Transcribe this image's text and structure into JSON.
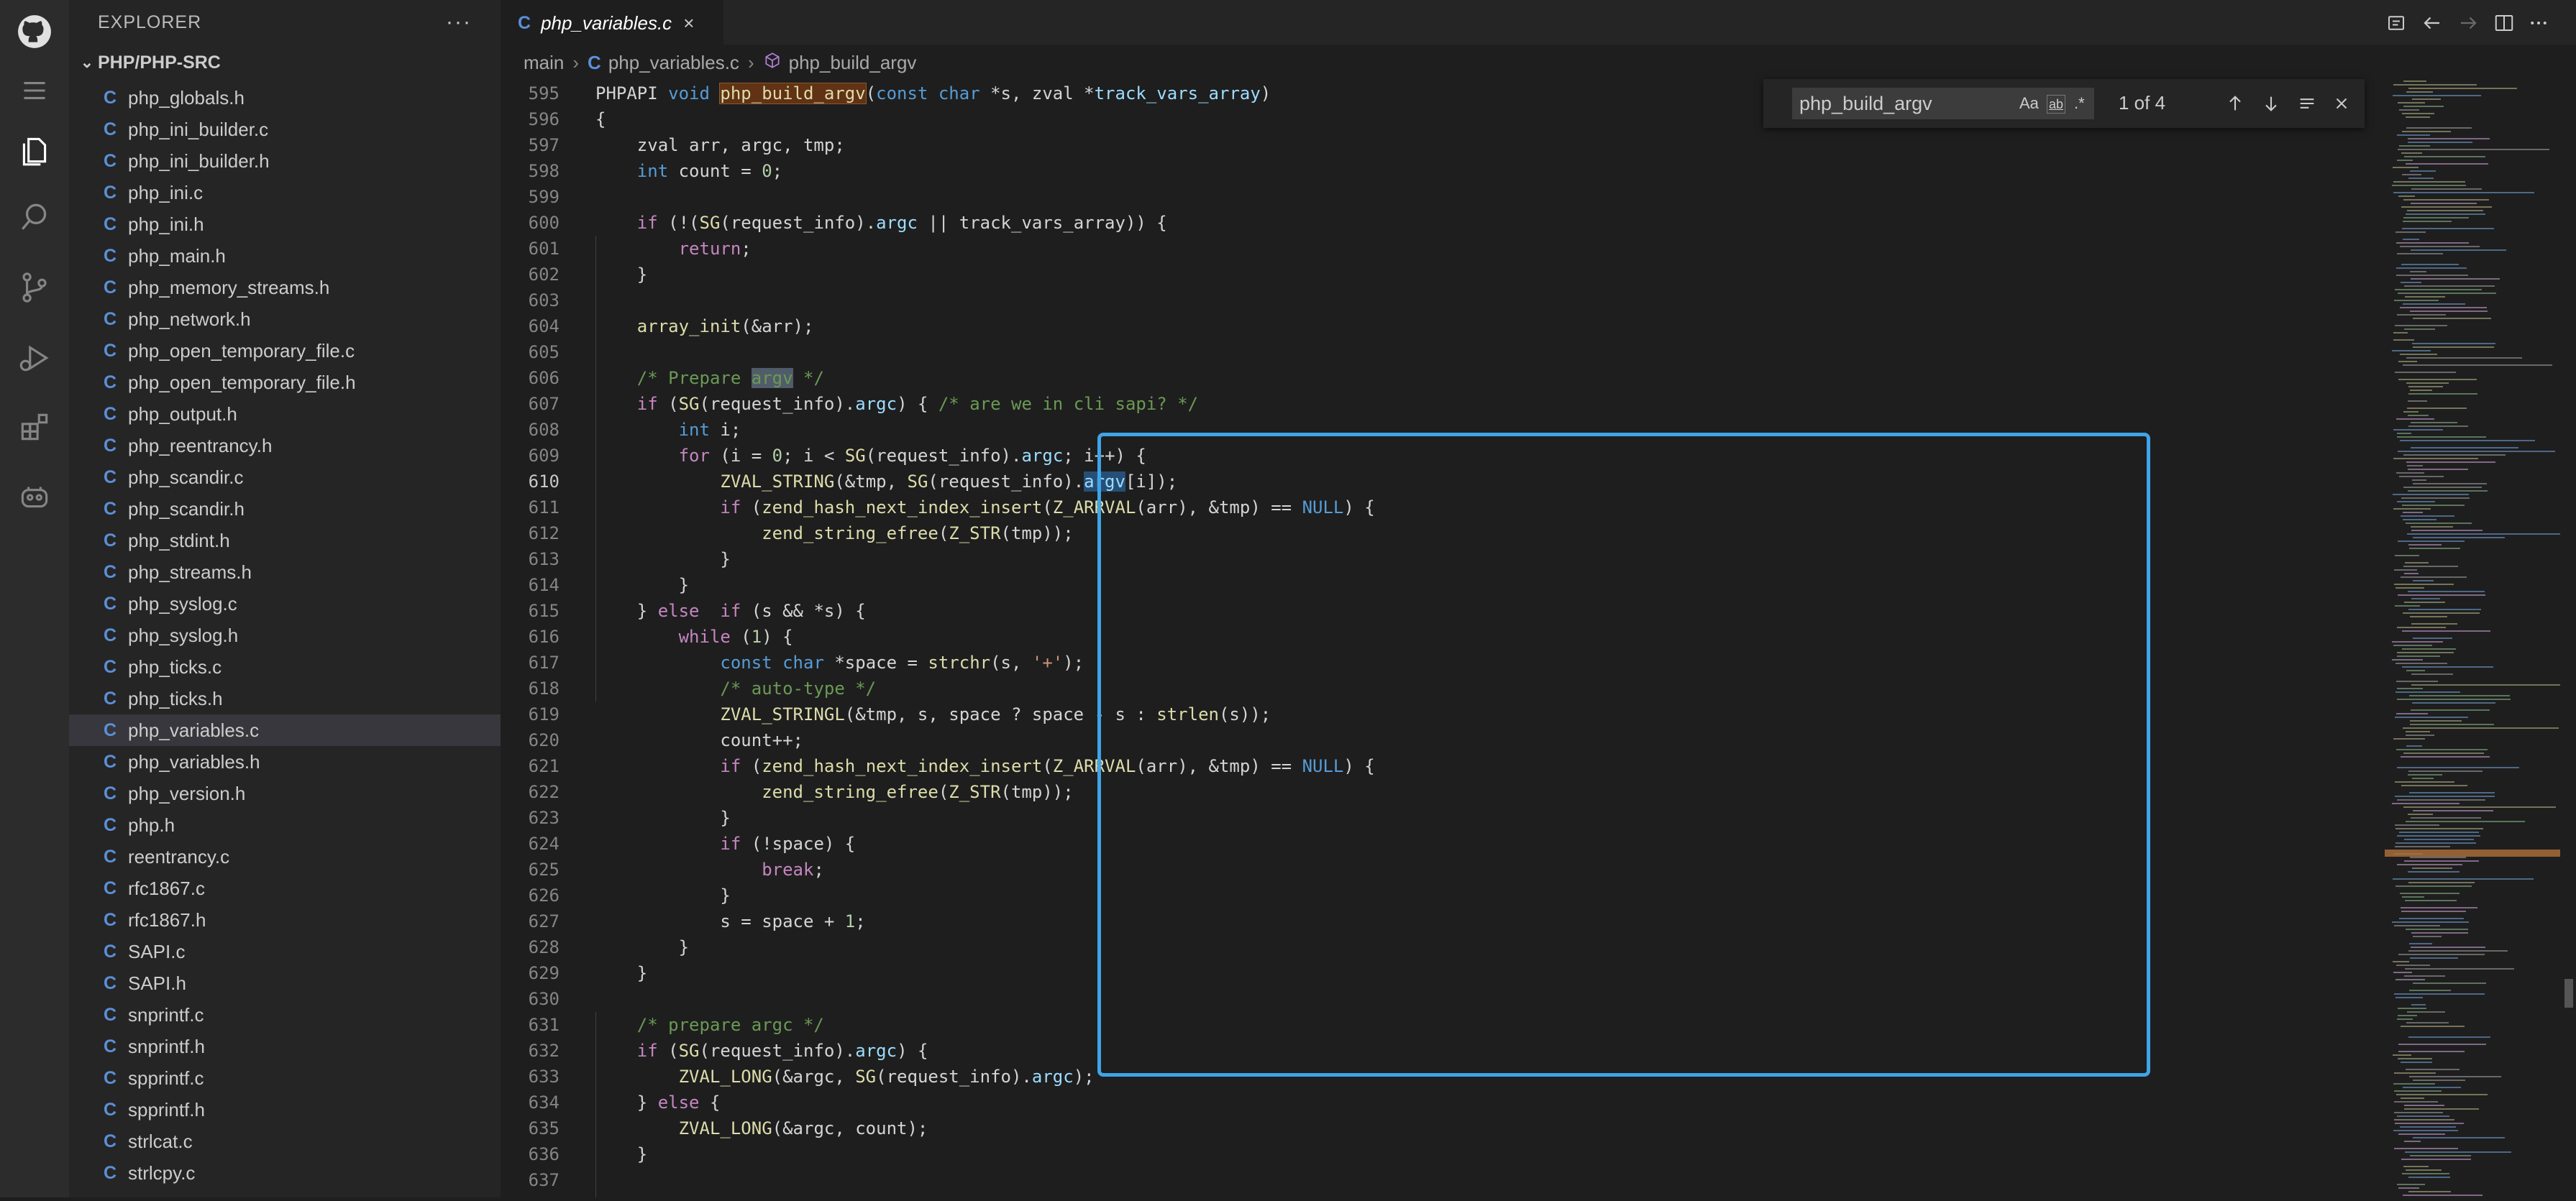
{
  "activity_bar": {
    "items": [
      "github-icon",
      "menu-icon",
      "files-icon",
      "search-icon",
      "source-control-icon",
      "run-debug-icon",
      "extensions-icon",
      "copilot-icon"
    ]
  },
  "sidebar": {
    "title": "EXPLORER",
    "more": "···",
    "folder": "PHP/PHP-SRC",
    "file_icon": "C",
    "files": [
      "php_globals.h",
      "php_ini_builder.c",
      "php_ini_builder.h",
      "php_ini.c",
      "php_ini.h",
      "php_main.h",
      "php_memory_streams.h",
      "php_network.h",
      "php_open_temporary_file.c",
      "php_open_temporary_file.h",
      "php_output.h",
      "php_reentrancy.h",
      "php_scandir.c",
      "php_scandir.h",
      "php_stdint.h",
      "php_streams.h",
      "php_syslog.c",
      "php_syslog.h",
      "php_ticks.c",
      "php_ticks.h",
      "php_variables.c",
      "php_variables.h",
      "php_version.h",
      "php.h",
      "reentrancy.c",
      "rfc1867.c",
      "rfc1867.h",
      "SAPI.c",
      "SAPI.h",
      "snprintf.c",
      "snprintf.h",
      "spprintf.c",
      "spprintf.h",
      "strlcat.c",
      "strlcpy.c"
    ],
    "active_file": "php_variables.c"
  },
  "tab": {
    "label": "php_variables.c",
    "close": "×"
  },
  "breadcrumb": {
    "root": "main",
    "file": "php_variables.c",
    "symbol": "php_build_argv"
  },
  "find": {
    "query": "php_build_argv",
    "count": "1 of 4",
    "opt_case": "Aa",
    "opt_word": "ab",
    "opt_regex": ".*"
  },
  "editor": {
    "current_line": "610",
    "lines": [
      {
        "n": "595"
      },
      {
        "n": "596"
      },
      {
        "n": "597"
      },
      {
        "n": "598"
      },
      {
        "n": "599"
      },
      {
        "n": "600"
      },
      {
        "n": "601"
      },
      {
        "n": "602"
      },
      {
        "n": "603"
      },
      {
        "n": "604"
      },
      {
        "n": "605"
      },
      {
        "n": "606"
      },
      {
        "n": "607"
      },
      {
        "n": "608"
      },
      {
        "n": "609"
      },
      {
        "n": "610"
      },
      {
        "n": "611"
      },
      {
        "n": "612"
      },
      {
        "n": "613"
      },
      {
        "n": "614"
      },
      {
        "n": "615"
      },
      {
        "n": "616"
      },
      {
        "n": "617"
      },
      {
        "n": "618"
      },
      {
        "n": "619"
      },
      {
        "n": "620"
      },
      {
        "n": "621"
      },
      {
        "n": "622"
      },
      {
        "n": "623"
      },
      {
        "n": "624"
      },
      {
        "n": "625"
      },
      {
        "n": "626"
      },
      {
        "n": "627"
      },
      {
        "n": "628"
      },
      {
        "n": "629"
      },
      {
        "n": "630"
      },
      {
        "n": "631"
      },
      {
        "n": "632"
      },
      {
        "n": "633"
      },
      {
        "n": "634"
      },
      {
        "n": "635"
      },
      {
        "n": "636"
      },
      {
        "n": "637"
      }
    ],
    "code": {
      "595": [
        "PHPAPI ",
        "void",
        " ",
        "php_build_argv",
        "(",
        "const",
        " ",
        "char",
        " *s, zval *",
        "track_vars_array",
        ")"
      ],
      "596": [
        "{"
      ],
      "597": [
        "    zval arr, argc, tmp;"
      ],
      "598": [
        "    ",
        "int",
        " count = ",
        "0",
        ";"
      ],
      "599": [
        ""
      ],
      "600": [
        "    ",
        "if",
        " (!(",
        "SG",
        "(request_info).",
        "argc",
        " || track_vars_array)) {"
      ],
      "601": [
        "        ",
        "return",
        ";"
      ],
      "602": [
        "    }"
      ],
      "603": [
        ""
      ],
      "604": [
        "    ",
        "array_init",
        "(&arr);"
      ],
      "605": [
        ""
      ],
      "606": [
        "    ",
        "/* Prepare ",
        "argv",
        " */"
      ],
      "607": [
        "    ",
        "if",
        " (",
        "SG",
        "(request_info).",
        "argc",
        ") { ",
        "/* are we in cli sapi? */"
      ],
      "608": [
        "        ",
        "int",
        " i;"
      ],
      "609": [
        "        ",
        "for",
        " (i = ",
        "0",
        "; i < ",
        "SG",
        "(request_info).",
        "argc",
        "; i++) {"
      ],
      "610": [
        "            ",
        "ZVAL_STRING",
        "(&tmp, ",
        "SG",
        "(request_info).",
        "argv",
        "[i]);"
      ],
      "611": [
        "            ",
        "if",
        " (",
        "zend_hash_next_index_insert",
        "(",
        "Z_ARRVAL",
        "(arr), &tmp) == ",
        "NULL",
        ") {"
      ],
      "612": [
        "                ",
        "zend_string_efree",
        "(",
        "Z_STR",
        "(tmp));"
      ],
      "613": [
        "            }"
      ],
      "614": [
        "        }"
      ],
      "615": [
        "    } ",
        "else",
        "  ",
        "if",
        " (s && *s) {"
      ],
      "616": [
        "        ",
        "while",
        " (",
        "1",
        ") {"
      ],
      "617": [
        "            ",
        "const",
        " ",
        "char",
        " *space = ",
        "strchr",
        "(s, ",
        "'+'",
        ");"
      ],
      "618": [
        "            ",
        "/* auto-type */"
      ],
      "619": [
        "            ",
        "ZVAL_STRINGL",
        "(&tmp, s, space ? space - s : ",
        "strlen",
        "(s));"
      ],
      "620": [
        "            count++;"
      ],
      "621": [
        "            ",
        "if",
        " (",
        "zend_hash_next_index_insert",
        "(",
        "Z_ARRVAL",
        "(arr), &tmp) == ",
        "NULL",
        ") {"
      ],
      "622": [
        "                ",
        "zend_string_efree",
        "(",
        "Z_STR",
        "(tmp));"
      ],
      "623": [
        "            }"
      ],
      "624": [
        "            ",
        "if",
        " (!space) {"
      ],
      "625": [
        "                ",
        "break",
        ";"
      ],
      "626": [
        "            }"
      ],
      "627": [
        "            s = space + ",
        "1",
        ";"
      ],
      "628": [
        "        }"
      ],
      "629": [
        "    }"
      ],
      "630": [
        ""
      ],
      "631": [
        "    ",
        "/* prepare argc */"
      ],
      "632": [
        "    ",
        "if",
        " (",
        "SG",
        "(request_info).",
        "argc",
        ") {"
      ],
      "633": [
        "        ",
        "ZVAL_LONG",
        "(&argc, ",
        "SG",
        "(request_info).",
        "argc",
        ");"
      ],
      "634": [
        "    } ",
        "else",
        " {"
      ],
      "635": [
        "        ",
        "ZVAL_LONG",
        "(&argc, count);"
      ],
      "636": [
        "    }"
      ],
      "637": [
        ""
      ]
    },
    "styles": {
      "595": [
        "",
        "kw",
        "",
        "fn hl",
        "",
        "kw",
        "",
        "kw",
        "",
        "var",
        ""
      ],
      "598": [
        "",
        "kw",
        "",
        "num",
        ""
      ],
      "600": [
        "",
        "ctl",
        "",
        "fn",
        "",
        "var",
        ""
      ],
      "601": [
        "",
        "ctl",
        ""
      ],
      "604": [
        "",
        "fn",
        ""
      ],
      "606": [
        "",
        "cmt",
        "cmt match",
        "cmt"
      ],
      "607": [
        "",
        "ctl",
        "",
        "fn",
        "",
        "var",
        "",
        "cmt"
      ],
      "608": [
        "",
        "kw",
        ""
      ],
      "609": [
        "",
        "ctl",
        "",
        "num",
        "",
        "fn",
        "",
        "var",
        ""
      ],
      "610": [
        "",
        "fn",
        "",
        "fn",
        "",
        "var sel",
        ""
      ],
      "611": [
        "",
        "ctl",
        "",
        "fn",
        "",
        "fn",
        "",
        "kw",
        ""
      ],
      "612": [
        "",
        "fn",
        "",
        "fn",
        ""
      ],
      "615": [
        "",
        "ctl",
        "",
        "ctl",
        ""
      ],
      "616": [
        "",
        "ctl",
        "",
        "num",
        ""
      ],
      "617": [
        "",
        "kw",
        "",
        "kw",
        "",
        "fn",
        "",
        "str",
        ""
      ],
      "618": [
        "",
        "cmt"
      ],
      "619": [
        "",
        "fn",
        "",
        "fn",
        ""
      ],
      "621": [
        "",
        "ctl",
        "",
        "fn",
        "",
        "fn",
        "",
        "kw",
        ""
      ],
      "622": [
        "",
        "fn",
        "",
        "fn",
        ""
      ],
      "624": [
        "",
        "ctl",
        ""
      ],
      "625": [
        "",
        "ctl",
        ""
      ],
      "627": [
        "",
        "num",
        ""
      ],
      "631": [
        "",
        "cmt"
      ],
      "632": [
        "",
        "ctl",
        "",
        "fn",
        "",
        "var",
        ""
      ],
      "633": [
        "",
        "fn",
        "",
        "fn",
        "",
        "var",
        ""
      ],
      "634": [
        "",
        "ctl",
        ""
      ],
      "635": [
        "",
        "fn",
        ""
      ]
    }
  }
}
